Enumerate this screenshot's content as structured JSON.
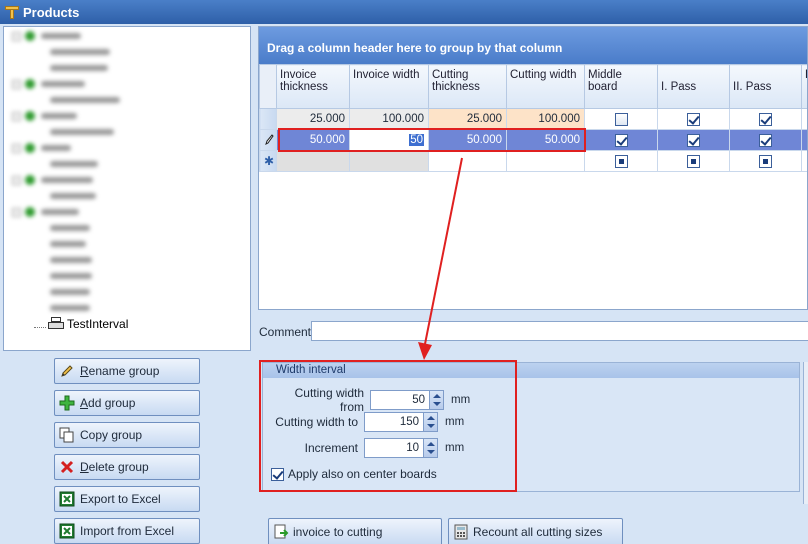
{
  "window": {
    "title": "Products"
  },
  "tree": {
    "leaf_label": "TestInterval"
  },
  "left_buttons": [
    {
      "label_u": "R",
      "label_rest": "ename group",
      "icon": "pencil-icon"
    },
    {
      "label_u": "A",
      "label_rest": "dd group",
      "icon": "plus-icon"
    },
    {
      "label_u": "",
      "label_rest": "Copy group",
      "icon": "copy-icon"
    },
    {
      "label_u": "D",
      "label_rest": "elete group",
      "icon": "delete-x-icon"
    },
    {
      "label_u": "",
      "label_rest": "Export to Excel",
      "icon": "excel-icon"
    },
    {
      "label_u": "",
      "label_rest": "Import from Excel",
      "icon": "excel-icon"
    }
  ],
  "grid": {
    "group_panel_text": "Drag a column header here to group by that column",
    "columns": [
      "Invoice thickness",
      "Invoice width",
      "Cutting thickness",
      "Cutting width",
      "Middle board",
      "I. Pass",
      "II. Pass",
      "P"
    ],
    "rows": [
      {
        "invoice_thickness": "25.000",
        "invoice_width": "100.000",
        "cutting_thickness": "25.000",
        "cutting_width": "100.000"
      },
      {
        "invoice_thickness": "50.000",
        "invoice_width": "50",
        "cutting_thickness": "50.000",
        "cutting_width": "50.000"
      }
    ]
  },
  "comment": {
    "label": "Comment",
    "value": ""
  },
  "width_interval": {
    "title": "Width interval",
    "from_label": "Cutting width from",
    "from_value": "50",
    "to_label": "Cutting width to",
    "to_value": "150",
    "increment_label": "Increment",
    "increment_value": "10",
    "unit": "mm",
    "apply_label": "Apply also on center boards",
    "apply_checked": true
  },
  "bottom_buttons": {
    "invoice_to_cutting": "invoice to cutting",
    "recount": "Recount all cutting sizes"
  },
  "colors": {
    "accent": "#4a7cc9",
    "selection": "#6f86d6",
    "annotation": "#e02020"
  }
}
